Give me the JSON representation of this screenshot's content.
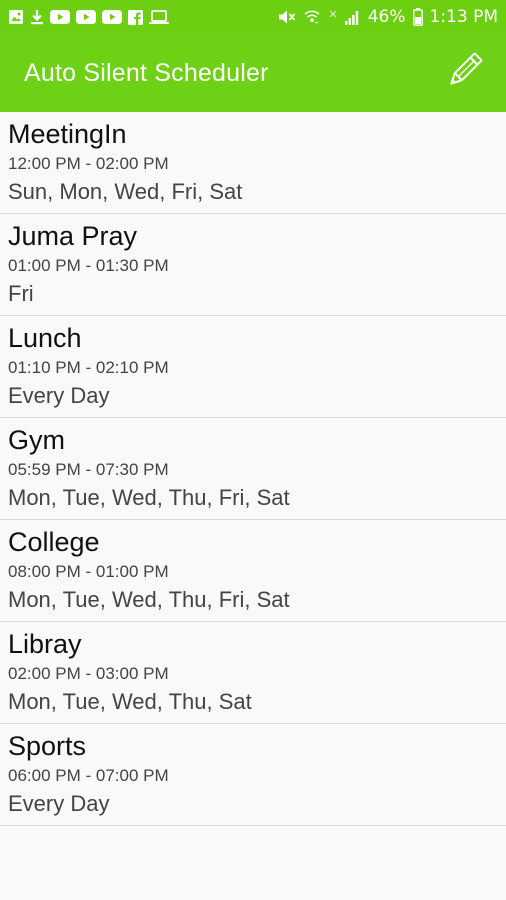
{
  "status_bar": {
    "battery": "46%",
    "time": "1:13 PM",
    "left_icons": [
      "image-icon",
      "download-icon",
      "youtube-icon",
      "youtube-icon",
      "youtube-icon",
      "facebook-icon",
      "laptop-icon"
    ],
    "right_icons": [
      "mute-icon",
      "wifi-icon",
      "no-signal-icon",
      "signal-icon",
      "battery-icon"
    ]
  },
  "app_bar": {
    "title": "Auto Silent Scheduler",
    "edit_icon": "pencil-icon"
  },
  "schedules": [
    {
      "name": "MeetingIn",
      "time": "12:00 PM - 02:00 PM",
      "days": "Sun, Mon, Wed, Fri, Sat"
    },
    {
      "name": "Juma Pray",
      "time": "01:00 PM - 01:30 PM",
      "days": "Fri"
    },
    {
      "name": "Lunch",
      "time": "01:10 PM - 02:10 PM",
      "days": "Every Day"
    },
    {
      "name": "Gym",
      "time": "05:59 PM - 07:30 PM",
      "days": "Mon, Tue, Wed, Thu, Fri, Sat"
    },
    {
      "name": "College",
      "time": "08:00 PM - 01:00 PM",
      "days": "Mon, Tue, Wed, Thu, Fri, Sat"
    },
    {
      "name": "Libray",
      "time": "02:00 PM - 03:00 PM",
      "days": "Mon, Tue, Wed, Thu, Sat"
    },
    {
      "name": "Sports",
      "time": "06:00 PM - 07:00 PM",
      "days": "Every Day"
    }
  ],
  "colors": {
    "status_bar": "#6ccf12",
    "app_bar": "#6fd116",
    "divider": "#d9d9d9"
  }
}
